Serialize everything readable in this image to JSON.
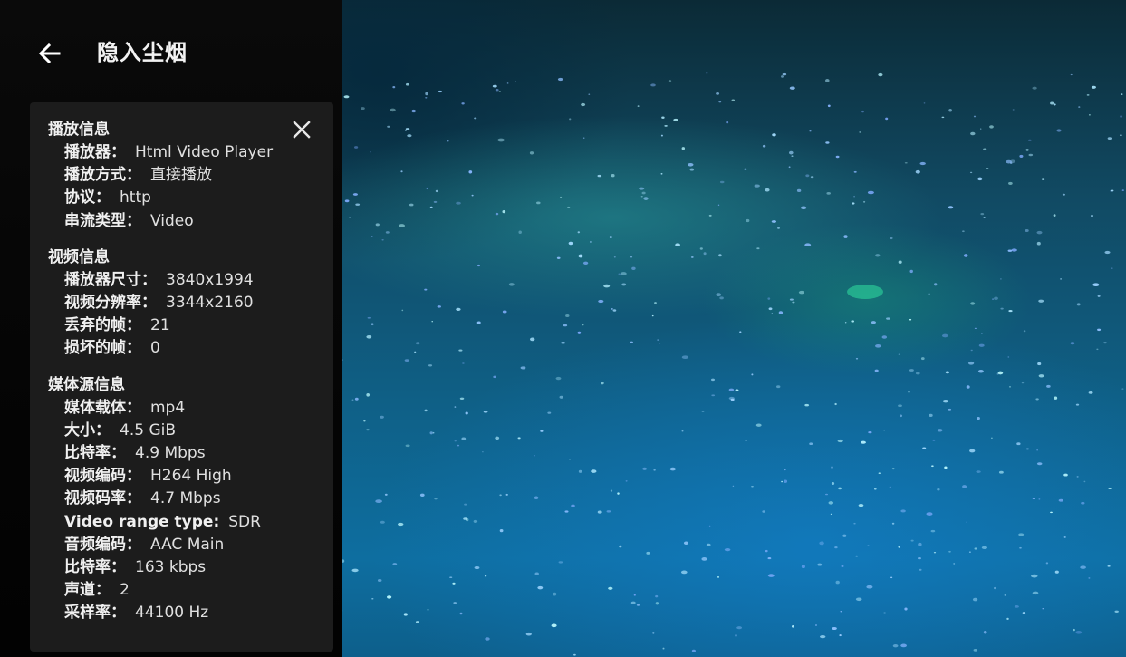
{
  "header": {
    "title": "隐入尘烟",
    "back_icon": "arrow-left-icon"
  },
  "info_panel": {
    "close_icon": "close-icon",
    "sections": [
      {
        "title": "播放信息",
        "rows": [
          {
            "label": "播放器：",
            "value": "Html Video Player"
          },
          {
            "label": "播放方式：",
            "value": "直接播放"
          },
          {
            "label": "协议：",
            "value": "http"
          },
          {
            "label": "串流类型：",
            "value": "Video"
          }
        ]
      },
      {
        "title": "视频信息",
        "rows": [
          {
            "label": "播放器尺寸：",
            "value": "3840x1994"
          },
          {
            "label": "视频分辨率：",
            "value": "3344x2160"
          },
          {
            "label": "丢弃的帧：",
            "value": "21"
          },
          {
            "label": "损坏的帧：",
            "value": "0"
          }
        ]
      },
      {
        "title": "媒体源信息",
        "rows": [
          {
            "label": "媒体载体：",
            "value": "mp4"
          },
          {
            "label": "大小：",
            "value": "4.5 GiB"
          },
          {
            "label": "比特率：",
            "value": "4.9 Mbps"
          },
          {
            "label": "视频编码：",
            "value": "H264 High"
          },
          {
            "label": "视频码率：",
            "value": "4.7 Mbps"
          },
          {
            "label": "Video range type:",
            "value": "SDR"
          },
          {
            "label": "音频编码：",
            "value": "AAC Main"
          },
          {
            "label": "比特率：",
            "value": "163 kbps"
          },
          {
            "label": "声道：",
            "value": "2"
          },
          {
            "label": "采样率：",
            "value": "44100 Hz"
          }
        ]
      }
    ]
  },
  "colors": {
    "panel_bg": "#1c1c1c",
    "video_tint": "#0f5f85"
  }
}
